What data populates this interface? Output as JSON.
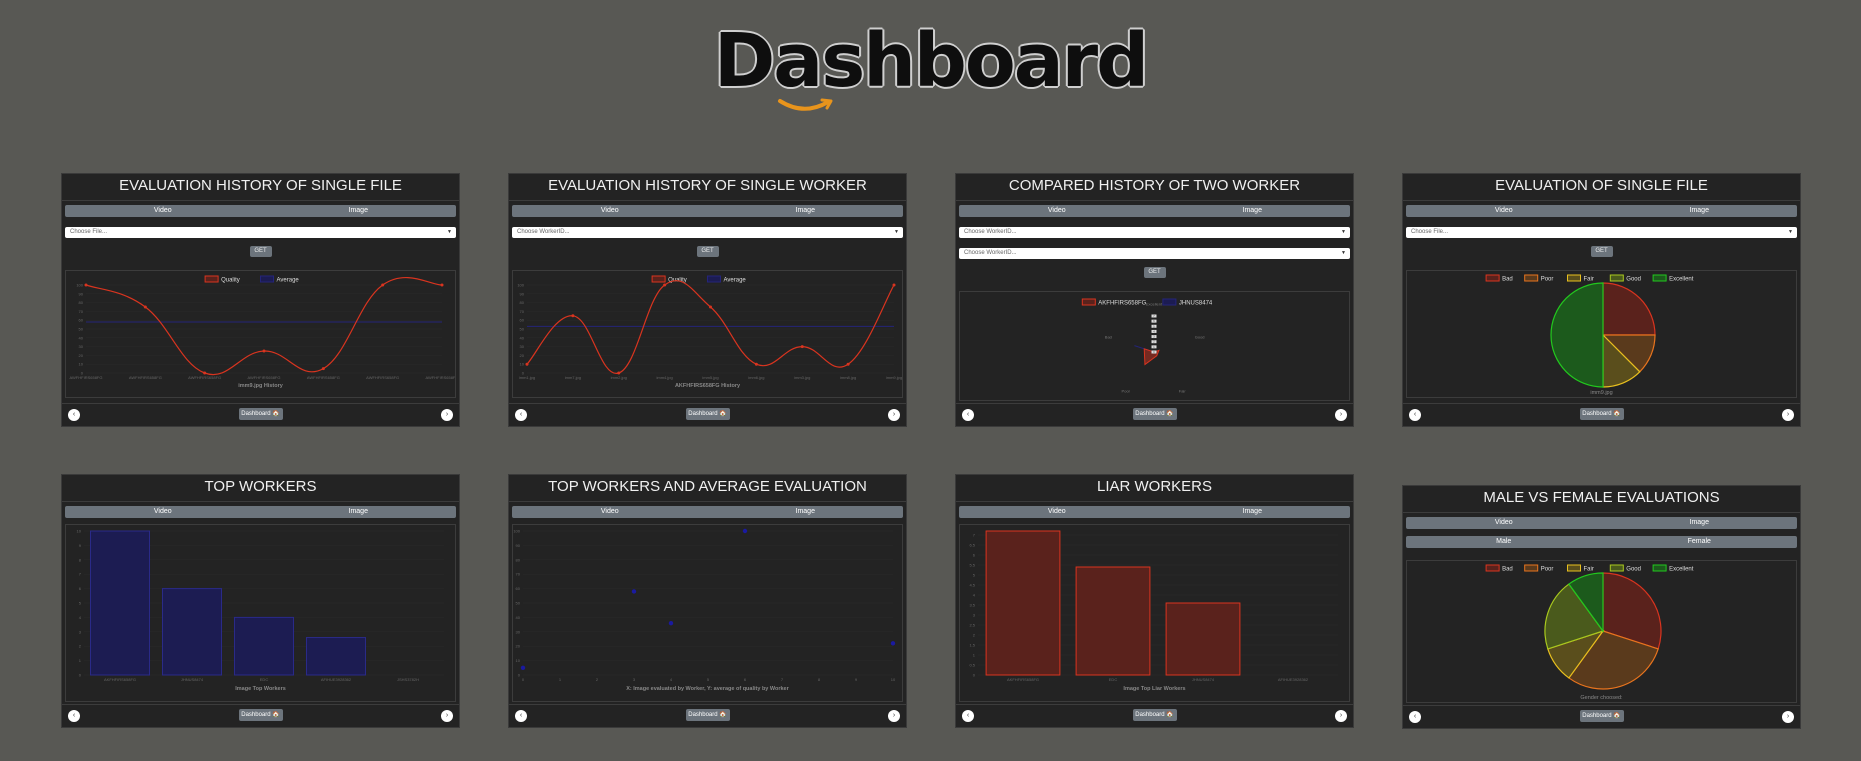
{
  "page": {
    "title": "Dashboard"
  },
  "common": {
    "tab_video": "Video",
    "tab_image": "Image",
    "get": "GET",
    "dashboard": "Dashboard 🏠",
    "prev": "‹",
    "next": "›"
  },
  "colors": {
    "red": "#d9341f",
    "blue": "#24247a",
    "redfill": "#5a221c",
    "bluefill": "#1c1c52",
    "bad": "#d9341f",
    "poor": "#e8741e",
    "fair": "#e8c01e",
    "good": "#a8c81e",
    "excellent": "#22c81e"
  },
  "cards": {
    "c1": {
      "title": "EVALUATION HISTORY OF SINGLE FILE",
      "select": "Choose File..."
    },
    "c2": {
      "title": "EVALUATION HISTORY OF SINGLE WORKER",
      "select": "Choose WorkerID..."
    },
    "c3": {
      "title": "COMPARED HISTORY OF TWO WORKER",
      "select1": "Choose WorkerID...",
      "select2": "Choose WorkerID..."
    },
    "c4": {
      "title": "EVALUATION OF SINGLE FILE",
      "select": "Choose File..."
    },
    "c5": {
      "title": "TOP WORKERS"
    },
    "c6": {
      "title": "TOP WORKERS AND AVERAGE EVALUATION"
    },
    "c7": {
      "title": "LIAR WORKERS"
    },
    "c8": {
      "title": "MALE VS FEMALE EVALUATIONS",
      "tab_male": "Male",
      "tab_female": "Female"
    }
  },
  "chart_data": [
    {
      "id": "c1",
      "type": "line",
      "legend": [
        "Quality",
        "Average"
      ],
      "xlabel": "imm9.jpg History",
      "x": [
        "AWFHFIRS658FG",
        "AWFHFIRS658FG",
        "AWFHFIRS658FG",
        "AWFHFIRS658FG",
        "AWFHFIRS658FG",
        "AWFHFIRS658FG",
        "AWFHFIRS658FG"
      ],
      "series": [
        {
          "name": "Quality",
          "values": [
            100,
            75,
            0,
            25,
            5,
            100,
            100
          ]
        },
        {
          "name": "Average",
          "values": [
            58,
            58,
            58,
            58,
            58,
            58,
            58
          ]
        }
      ],
      "ylim": [
        0,
        100
      ],
      "yticks": [
        0,
        10,
        20,
        30,
        40,
        50,
        60,
        70,
        80,
        90,
        100
      ]
    },
    {
      "id": "c2",
      "type": "line",
      "legend": [
        "Quality",
        "Average"
      ],
      "xlabel": "AKFHFIRS658FG History",
      "x": [
        "imm1.jpg",
        "imm7.jpg",
        "imm2.jpg",
        "imm4.jpg",
        "imm5.jpg",
        "imm6.jpg",
        "imm3.jpg",
        "imm8.jpg",
        "imm9.jpg"
      ],
      "series": [
        {
          "name": "Quality",
          "values": [
            10,
            65,
            0,
            100,
            75,
            10,
            30,
            10,
            100
          ]
        },
        {
          "name": "Average",
          "values": [
            53,
            53,
            53,
            53,
            53,
            53,
            53,
            53,
            53
          ]
        }
      ],
      "ylim": [
        0,
        100
      ],
      "yticks": [
        0,
        10,
        20,
        30,
        40,
        50,
        60,
        70,
        80,
        90,
        100
      ]
    },
    {
      "id": "c3",
      "type": "radar",
      "legend": [
        "AKFHFIRS658FG",
        "JHNUS8474"
      ],
      "axes": [
        "Excellent",
        "Good",
        "Fair",
        "Poor",
        "Bad"
      ],
      "series": [
        {
          "name": "AKFHFIRS658FG",
          "values": [
            0,
            1,
            0.9,
            3,
            2
          ]
        },
        {
          "name": "JHNUS8474",
          "values": [
            0,
            0,
            0,
            0,
            4
          ]
        }
      ],
      "rticks": [
        0,
        1,
        2,
        3,
        4,
        5,
        6,
        7
      ]
    },
    {
      "id": "c4",
      "type": "pie",
      "legend": [
        "Bad",
        "Poor",
        "Fair",
        "Good",
        "Excellent"
      ],
      "xlabel": "imm9.jpg",
      "values": [
        2,
        1,
        1,
        0,
        4
      ]
    },
    {
      "id": "c5",
      "type": "bar",
      "xlabel": "Image Top Workers",
      "categories": [
        "AKFHFIRS658FG",
        "JHNUS8474",
        "EDC",
        "AFIHUE3928362",
        "JSHS3782H"
      ],
      "values": [
        10,
        6,
        4,
        2.6,
        0
      ],
      "ylim": [
        0,
        10
      ],
      "yticks": [
        0,
        1,
        2,
        3,
        4,
        5,
        6,
        7,
        8,
        9,
        10
      ]
    },
    {
      "id": "c6",
      "type": "scatter",
      "xlabel": "X: Image evaluated by Worker, Y: average of quality by Worker",
      "points": [
        [
          0,
          5
        ],
        [
          3,
          58
        ],
        [
          4,
          36
        ],
        [
          6,
          100
        ],
        [
          10,
          22
        ]
      ],
      "xlim": [
        0,
        10
      ],
      "ylim": [
        0,
        100
      ],
      "xticks": [
        0,
        1,
        2,
        3,
        4,
        5,
        6,
        7,
        8,
        9,
        10
      ],
      "yticks": [
        0,
        10,
        20,
        30,
        40,
        50,
        60,
        70,
        80,
        90,
        100
      ]
    },
    {
      "id": "c7",
      "type": "bar",
      "xlabel": "Image Top Liar Workers",
      "categories": [
        "AKFHFIRS658FG",
        "EDC",
        "JHNUS8474",
        "AFIHUE3928362"
      ],
      "values": [
        7.2,
        5.4,
        3.6,
        0
      ],
      "ylim": [
        0,
        7.2
      ],
      "yticks": [
        0,
        0.5,
        1,
        1.5,
        2,
        2.5,
        3,
        3.5,
        4,
        4.5,
        5,
        5.5,
        6,
        6.5,
        7
      ]
    },
    {
      "id": "c8",
      "type": "pie",
      "legend": [
        "Bad",
        "Poor",
        "Fair",
        "Good",
        "Excellent"
      ],
      "xlabel": "Gender choosed:",
      "values": [
        3,
        3,
        1,
        2,
        1
      ]
    }
  ]
}
